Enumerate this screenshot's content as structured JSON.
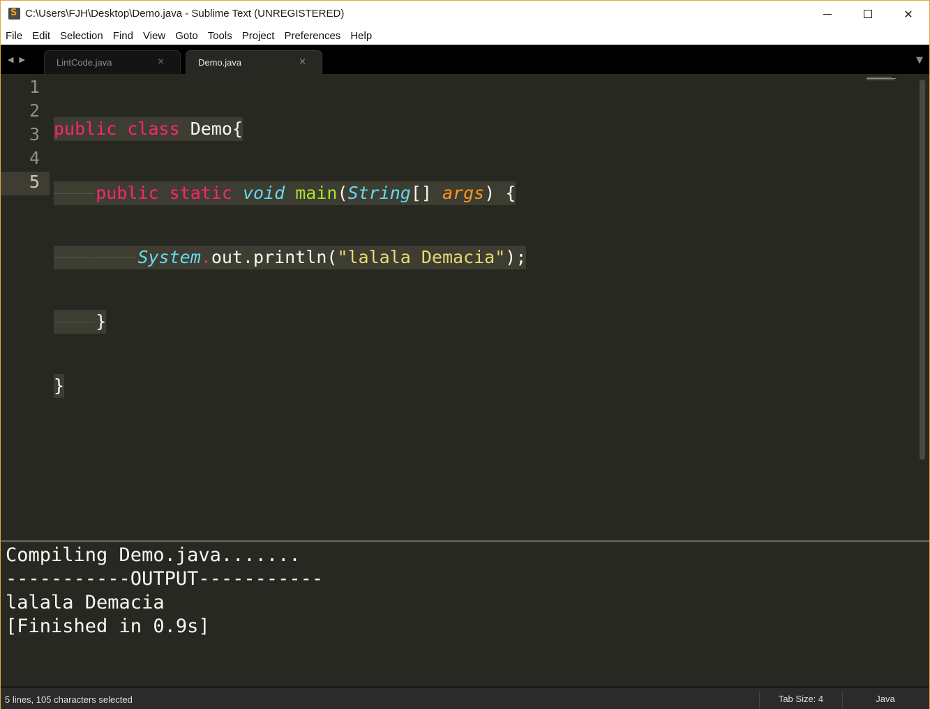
{
  "window": {
    "title": "C:\\Users\\FJH\\Desktop\\Demo.java - Sublime Text (UNREGISTERED)"
  },
  "menu": [
    "File",
    "Edit",
    "Selection",
    "Find",
    "View",
    "Goto",
    "Tools",
    "Project",
    "Preferences",
    "Help"
  ],
  "tabs": [
    {
      "label": "LintCode.java",
      "active": false
    },
    {
      "label": "Demo.java",
      "active": true
    }
  ],
  "editor": {
    "line_numbers": [
      "1",
      "2",
      "3",
      "4",
      "5"
    ],
    "current_line": "5",
    "code_lines": [
      "public class Demo{",
      "    public static void main(String[] args) {",
      "        System.out.println(\"lalala Demacia\");",
      "    }",
      "}"
    ]
  },
  "output": {
    "lines": [
      "Compiling Demo.java.......",
      "-----------OUTPUT-----------",
      "lalala Demacia",
      "[Finished in 0.9s]"
    ]
  },
  "status": {
    "selection": "5 lines, 105 characters selected",
    "tab_size": "Tab Size: 4",
    "syntax": "Java"
  },
  "colors": {
    "editor_bg": "#272822",
    "keyword": "#f92672",
    "storage_type": "#66d9ef",
    "function": "#a6e22e",
    "argument": "#fd971f",
    "string": "#e6db74",
    "window_border": "#e8a33d"
  }
}
